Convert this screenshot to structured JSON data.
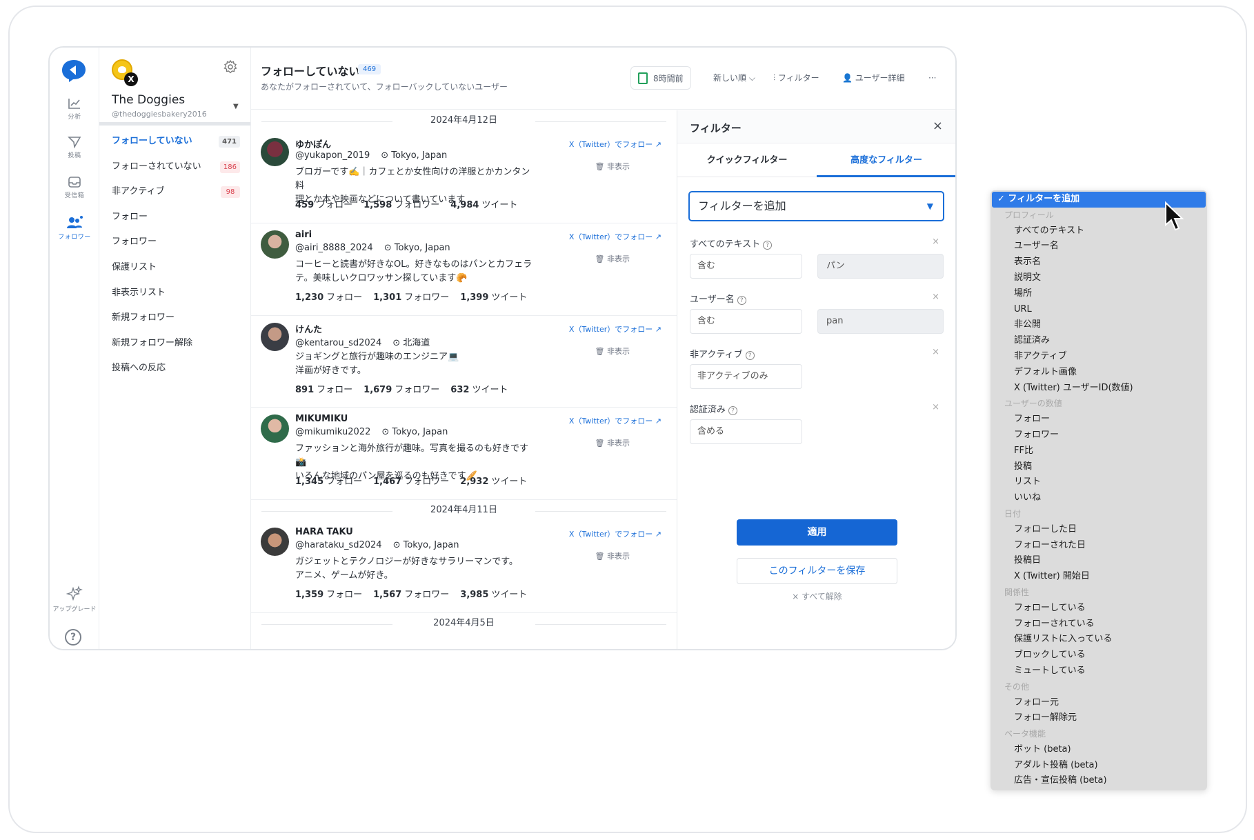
{
  "rail": {
    "items": [
      {
        "label": "分析"
      },
      {
        "label": "投稿"
      },
      {
        "label": "受信箱"
      },
      {
        "label": "フォロワー"
      }
    ],
    "upgrade": "アップグレード",
    "help": "?"
  },
  "account": {
    "name": "The Doggies",
    "handle": "@thedoggiesbakery2016",
    "x_badge": "X"
  },
  "nav": [
    {
      "label": "フォローしていない",
      "badge": "471"
    },
    {
      "label": "フォローされていない",
      "badge": "186"
    },
    {
      "label": "非アクティブ",
      "badge": "98"
    },
    {
      "label": "フォロー",
      "badge": ""
    },
    {
      "label": "フォロワー",
      "badge": ""
    },
    {
      "label": "保護リスト",
      "badge": ""
    },
    {
      "label": "非表示リスト",
      "badge": ""
    },
    {
      "label": "新規フォロワー",
      "badge": ""
    },
    {
      "label": "新規フォロワー解除",
      "badge": ""
    },
    {
      "label": "投稿への反応",
      "badge": ""
    }
  ],
  "header": {
    "title": "フォローしていない",
    "count": "469",
    "subtitle": "あなたがフォローされていて、フォローバックしていないユーザー",
    "updated": "8時間前",
    "sort": "新しい順",
    "filter": "フィルター",
    "user_detail": "ユーザー詳細",
    "more": "···"
  },
  "dates": [
    "2024年4月12日",
    "2024年4月11日",
    "2024年4月5日"
  ],
  "users": [
    {
      "name": "ゆかぽん",
      "handle": "@yukapon_2019",
      "location": "Tokyo, Japan",
      "bio1": "ブロガーです✍️｜カフェとか女性向けの洋服とかカンタン料",
      "bio2": "理とか本や映画などについて書いています",
      "following": "459",
      "followers": "1,598",
      "tweets": "4,984"
    },
    {
      "name": "airi",
      "handle": "@airi_8888_2024",
      "location": "Tokyo, Japan",
      "bio1": " コーヒーと読書が好きなOL。好きなものはパンとカフェラ",
      "bio2": "テ。美味しいクロワッサン探しています🥐",
      "following": "1,230",
      "followers": "1,301",
      "tweets": "1,399"
    },
    {
      "name": "けんた",
      "handle": "@kentarou_sd2024",
      "location": "北海道",
      "bio1": "ジョギングと旅行が趣味のエンジニア💻",
      "bio2": "洋画が好きです。",
      "following": "891",
      "followers": "1,679",
      "tweets": "632"
    },
    {
      "name": "MIKUMIKU",
      "handle": "@mikumiku2022",
      "location": "Tokyo, Japan",
      "bio1": "ファッションと海外旅行が趣味。写真を撮るのも好きです📸",
      "bio2": "いろんな地域のパン屋を巡るのも好きです🥖",
      "following": "1,345",
      "followers": "1,467",
      "tweets": "2,932"
    },
    {
      "name": "HARA TAKU",
      "handle": "@harataku_sd2024",
      "location": "Tokyo, Japan",
      "bio1": "ガジェットとテクノロジーが好きなサラリーマンです。",
      "bio2": "アニメ、ゲームが好き。",
      "following": "1,359",
      "followers": "1,567",
      "tweets": "3,985"
    }
  ],
  "row_labels": {
    "follow_link": "X（Twitter）でフォロー",
    "hide": "🗑 非表示",
    "following": "フォロー",
    "followers": "フォロワー",
    "tweets": "ツイート"
  },
  "filter": {
    "title": "フィルター",
    "close": "×",
    "tab_quick": "クイックフィルター",
    "tab_advanced": "高度なフィルター",
    "add_placeholder": "フィルターを追加",
    "groups": [
      {
        "label": "すべてのテキスト",
        "op": "含む",
        "value": "パン"
      },
      {
        "label": "ユーザー名",
        "op": "含む",
        "value": "pan"
      },
      {
        "label": "非アクティブ",
        "op": "非アクティブのみ",
        "value": ""
      },
      {
        "label": "認証済み",
        "op": "含める",
        "value": ""
      }
    ],
    "apply": "適用",
    "save": "このフィルターを保存",
    "clear": "× すべて解除"
  },
  "dropdown": [
    {
      "label": "✓ フィルターを追加",
      "kind": "selected"
    },
    {
      "label": "プロフィール",
      "kind": "group"
    },
    {
      "label": "すべてのテキスト",
      "kind": "item"
    },
    {
      "label": "ユーザー名",
      "kind": "item"
    },
    {
      "label": "表示名",
      "kind": "item"
    },
    {
      "label": "説明文",
      "kind": "item"
    },
    {
      "label": "場所",
      "kind": "item"
    },
    {
      "label": "URL",
      "kind": "item"
    },
    {
      "label": "非公開",
      "kind": "item"
    },
    {
      "label": "認証済み",
      "kind": "item"
    },
    {
      "label": "非アクティブ",
      "kind": "item"
    },
    {
      "label": "デフォルト画像",
      "kind": "item"
    },
    {
      "label": "X (Twitter) ユーザーID(数値)",
      "kind": "item"
    },
    {
      "label": "ユーザーの数値",
      "kind": "group"
    },
    {
      "label": "フォロー",
      "kind": "item"
    },
    {
      "label": "フォロワー",
      "kind": "item"
    },
    {
      "label": "FF比",
      "kind": "item"
    },
    {
      "label": "投稿",
      "kind": "item"
    },
    {
      "label": "リスト",
      "kind": "item"
    },
    {
      "label": "いいね",
      "kind": "item"
    },
    {
      "label": "日付",
      "kind": "group"
    },
    {
      "label": "フォローした日",
      "kind": "item"
    },
    {
      "label": "フォローされた日",
      "kind": "item"
    },
    {
      "label": "投稿日",
      "kind": "item"
    },
    {
      "label": "X (Twitter) 開始日",
      "kind": "item"
    },
    {
      "label": "関係性",
      "kind": "group"
    },
    {
      "label": "フォローしている",
      "kind": "item"
    },
    {
      "label": "フォローされている",
      "kind": "item"
    },
    {
      "label": "保護リストに入っている",
      "kind": "item"
    },
    {
      "label": "ブロックしている",
      "kind": "item"
    },
    {
      "label": "ミュートしている",
      "kind": "item"
    },
    {
      "label": "その他",
      "kind": "group"
    },
    {
      "label": "フォロー元",
      "kind": "item"
    },
    {
      "label": "フォロー解除元",
      "kind": "item"
    },
    {
      "label": "ベータ機能",
      "kind": "group"
    },
    {
      "label": "ボット (beta)",
      "kind": "item"
    },
    {
      "label": "アダルト投稿 (beta)",
      "kind": "item"
    },
    {
      "label": "広告・宣伝投稿 (beta)",
      "kind": "item"
    }
  ],
  "colors": {
    "accent": "#1a6ed8",
    "apply": "#1566d4",
    "dropdown_selected": "#2f7be8"
  }
}
